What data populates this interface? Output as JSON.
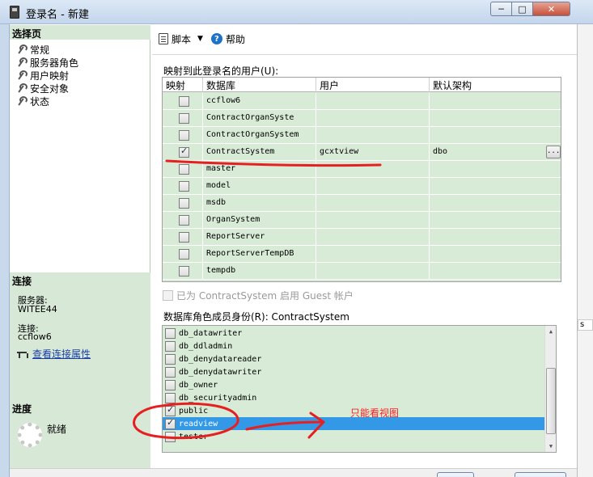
{
  "window": {
    "title": "登录名 - 新建",
    "min_label": "─",
    "max_label": "□",
    "close_label": "✕"
  },
  "left": {
    "select_page_header": "选择页",
    "pages": [
      "常规",
      "服务器角色",
      "用户映射",
      "安全对象",
      "状态"
    ],
    "connection_header": "连接",
    "server_label": "服务器:",
    "server_value": "WITEE44",
    "connection_label": "连接:",
    "connection_value": "ccflow6",
    "view_connection_link": "查看连接属性",
    "progress_header": "进度",
    "progress_status": "就绪"
  },
  "toolbar": {
    "script_label": "脚本",
    "help_label": "帮助"
  },
  "mapping": {
    "label": "映射到此登录名的用户(U):",
    "columns": [
      "映射",
      "数据库",
      "用户",
      "默认架构"
    ],
    "rows": [
      {
        "mapped": false,
        "database": "ccflow6",
        "user": "",
        "schema": ""
      },
      {
        "mapped": false,
        "database": "ContractOrganSyste",
        "user": "",
        "schema": ""
      },
      {
        "mapped": false,
        "database": "ContractOrganSystem",
        "user": "",
        "schema": ""
      },
      {
        "mapped": true,
        "database": "ContractSystem",
        "user": "gcxtview",
        "schema": "dbo"
      },
      {
        "mapped": false,
        "database": "master",
        "user": "",
        "schema": ""
      },
      {
        "mapped": false,
        "database": "model",
        "user": "",
        "schema": ""
      },
      {
        "mapped": false,
        "database": "msdb",
        "user": "",
        "schema": ""
      },
      {
        "mapped": false,
        "database": "OrganSystem",
        "user": "",
        "schema": ""
      },
      {
        "mapped": false,
        "database": "ReportServer",
        "user": "",
        "schema": ""
      },
      {
        "mapped": false,
        "database": "ReportServerTempDB",
        "user": "",
        "schema": ""
      },
      {
        "mapped": false,
        "database": "tempdb",
        "user": "",
        "schema": ""
      }
    ],
    "ellipsis_label": "..."
  },
  "guest": {
    "label": "已为 ContractSystem 启用 Guest 帐户"
  },
  "roles": {
    "label": "数据库角色成员身份(R): ContractSystem",
    "items": [
      {
        "name": "db_datawriter",
        "checked": false,
        "selected": false
      },
      {
        "name": "db_ddladmin",
        "checked": false,
        "selected": false
      },
      {
        "name": "db_denydatareader",
        "checked": false,
        "selected": false
      },
      {
        "name": "db_denydatawriter",
        "checked": false,
        "selected": false
      },
      {
        "name": "db_owner",
        "checked": false,
        "selected": false
      },
      {
        "name": "db_securityadmin",
        "checked": false,
        "selected": false
      },
      {
        "name": "public",
        "checked": true,
        "selected": false
      },
      {
        "name": "readview",
        "checked": true,
        "selected": true
      },
      {
        "name": "tester",
        "checked": false,
        "selected": false
      }
    ]
  },
  "annotation": {
    "text": "只能看视图",
    "color": "#ff2020"
  },
  "background": {
    "edge_text": "s"
  },
  "colors": {
    "grid_bg": "#d7ebd7",
    "selection": "#3398e6",
    "section_bg": "#d7e8d7"
  }
}
